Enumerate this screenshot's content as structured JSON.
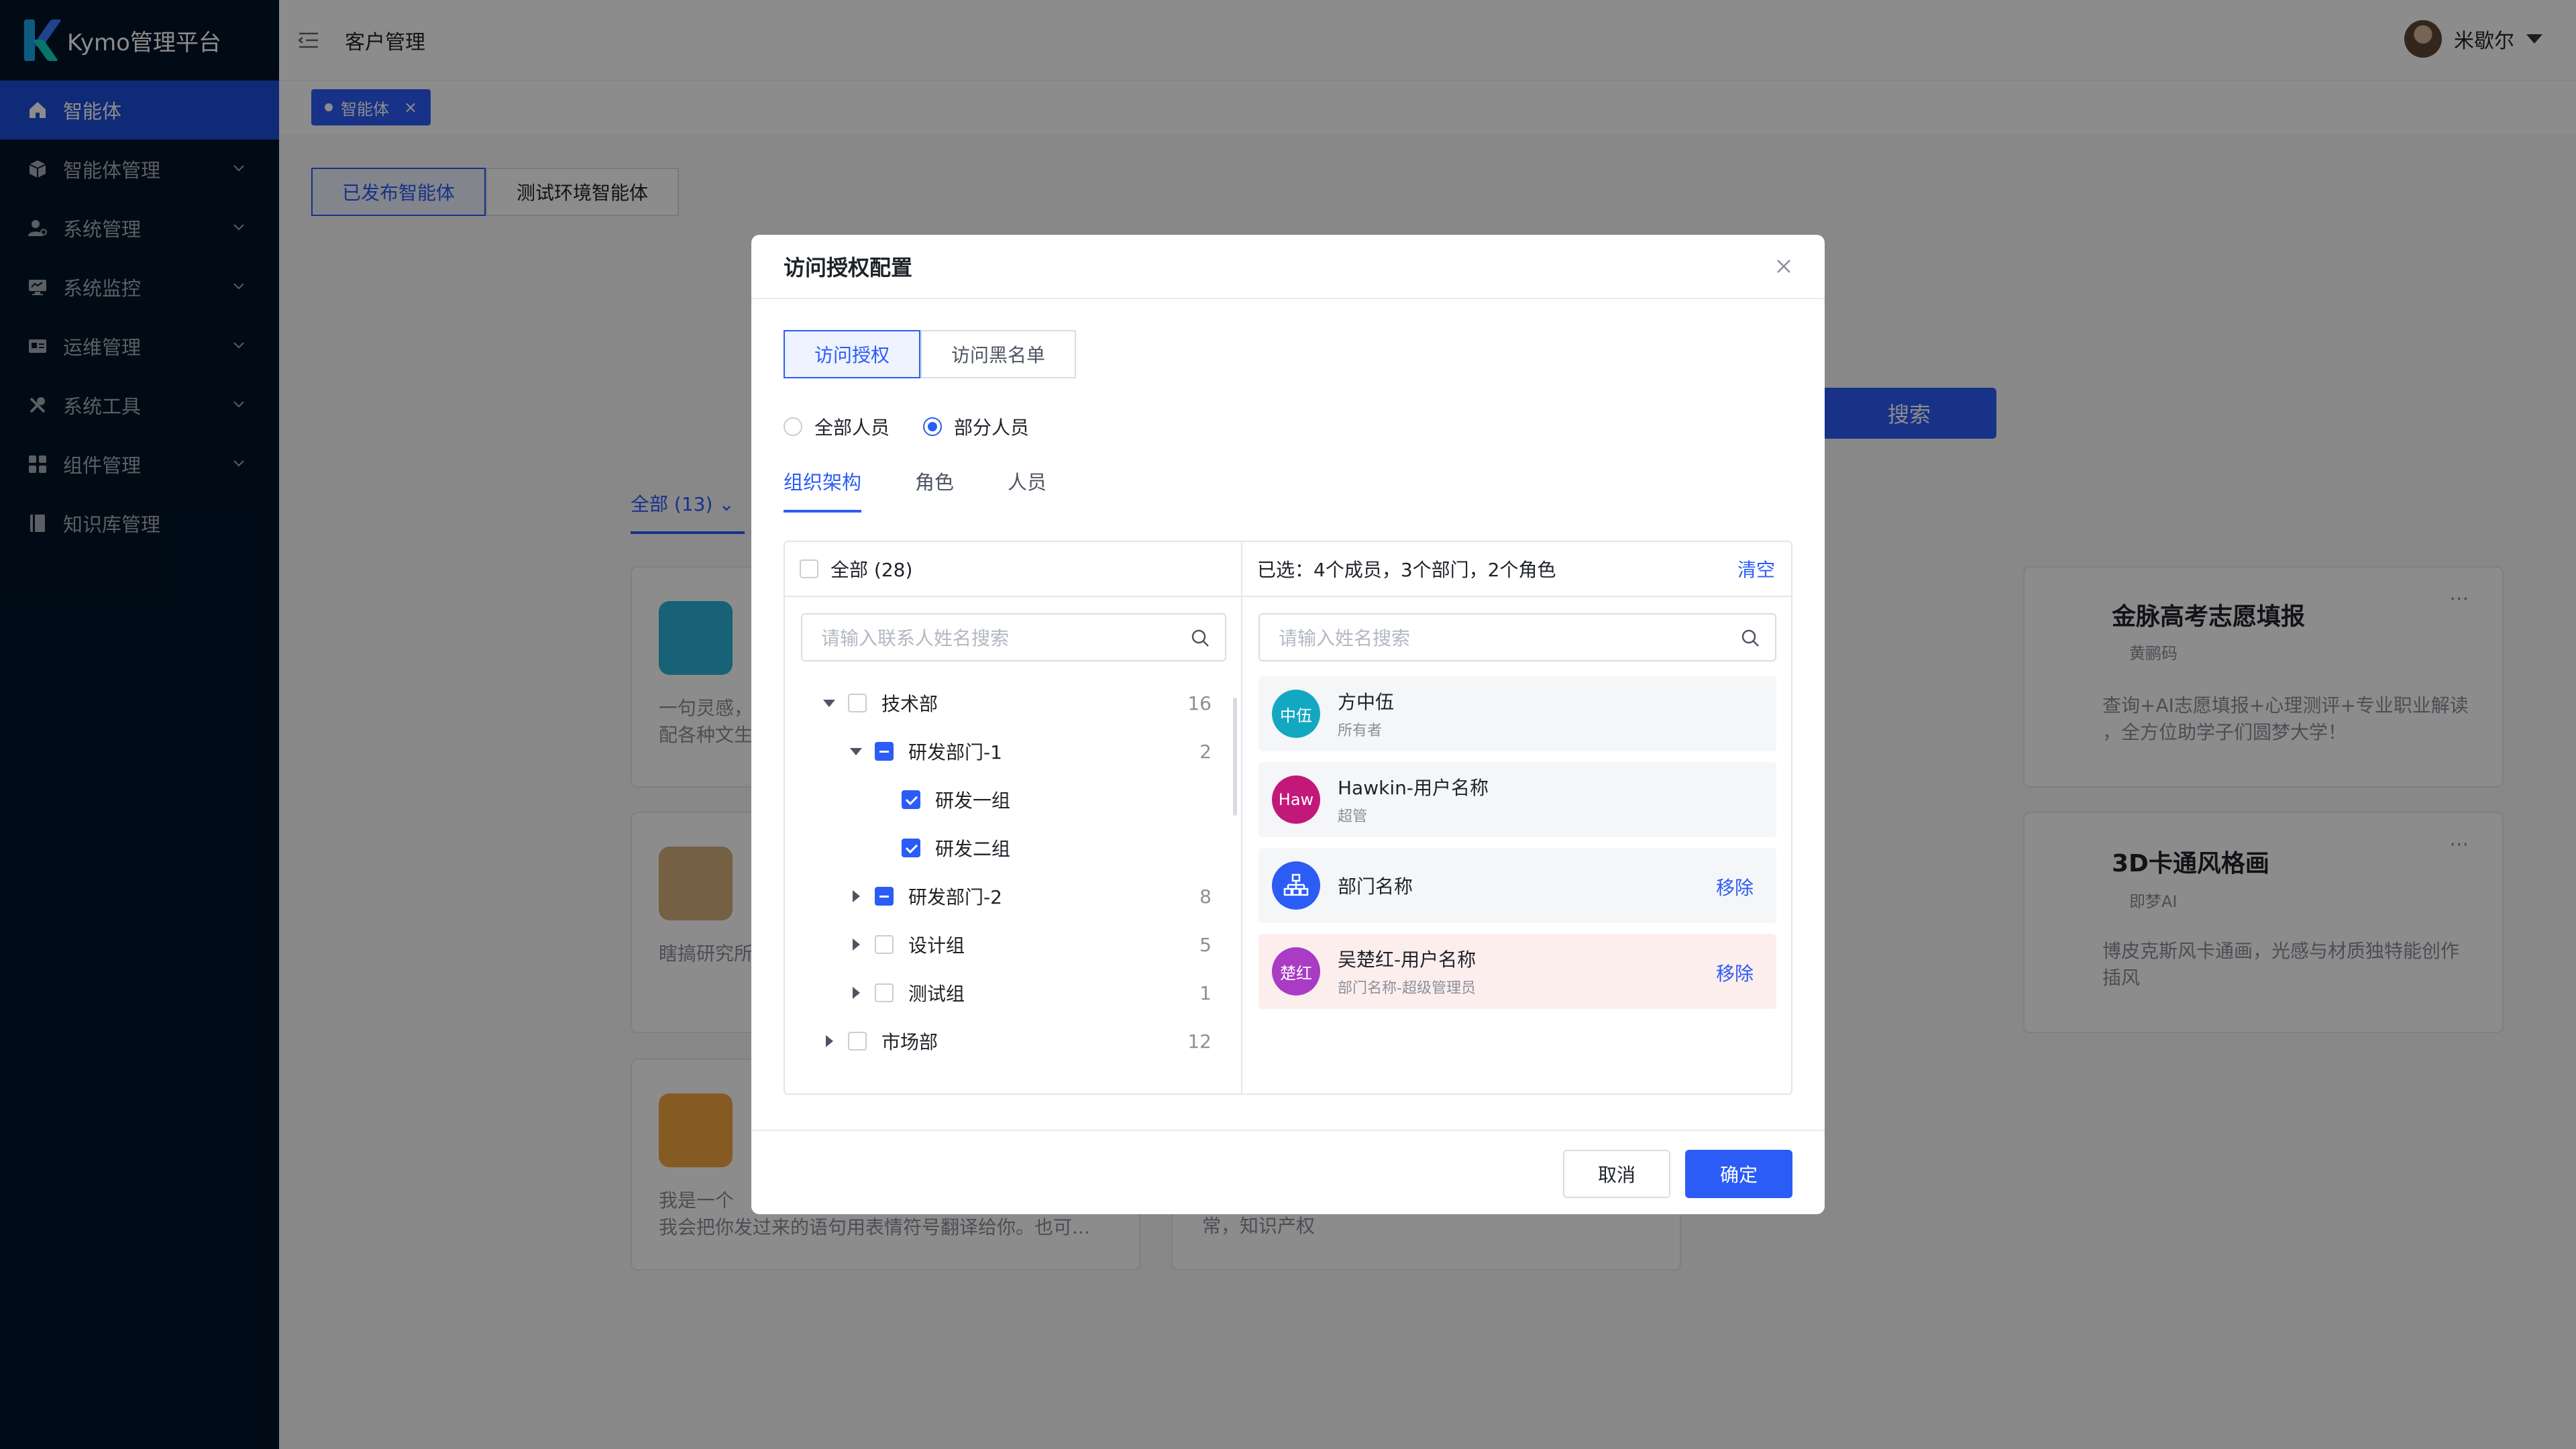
{
  "app": {
    "title": "Kymo管理平台"
  },
  "sidebar": {
    "items": [
      {
        "label": "智能体",
        "icon": "home-icon",
        "active": true
      },
      {
        "label": "智能体管理",
        "icon": "cube-icon"
      },
      {
        "label": "系统管理",
        "icon": "user-settings-icon"
      },
      {
        "label": "系统监控",
        "icon": "monitor-icon"
      },
      {
        "label": "运维管理",
        "icon": "id-card-icon"
      },
      {
        "label": "系统工具",
        "icon": "tools-icon"
      },
      {
        "label": "组件管理",
        "icon": "grid-icon"
      },
      {
        "label": "知识库管理",
        "icon": "book-icon"
      }
    ]
  },
  "header": {
    "title": "客户管理",
    "username": "米歇尔"
  },
  "tagbar": {
    "tag_label": "智能体"
  },
  "main": {
    "seg": [
      "已发布智能体",
      "测试环境智能体"
    ],
    "search_button": "搜索",
    "all_tab": "全部 (13)",
    "cards": [
      {
        "title": "",
        "sub": "",
        "desc1": "一句灵感，",
        "desc2": "配各种文生"
      },
      {
        "title": "金脉高考志愿填报",
        "sub": "黄鹂码",
        "desc1": "查询+AI志愿填报+心理测评+专业职业解读",
        "desc2": "，全方位助学子们圆梦大学！"
      },
      {
        "title": "",
        "sub": "",
        "desc1": "瞎搞研究所",
        "desc2": ""
      },
      {
        "title": "3D卡通风格画",
        "sub": "即梦AI",
        "desc1": "博皮克斯风卡通画，光感与材质独特能创作",
        "desc2": "插风"
      },
      {
        "title": "",
        "sub": "",
        "desc1": "我是一个",
        "desc2": "我会把你发过来的语句用表情符号翻译给你。也可..."
      },
      {
        "title": "",
        "sub": "",
        "desc1": "常，知识产权",
        "desc2": ""
      }
    ]
  },
  "modal": {
    "title": "访问授权配置",
    "tabs": [
      "访问授权",
      "访问黑名单"
    ],
    "radios": [
      "全部人员",
      "部分人员"
    ],
    "subtabs": [
      "组织架构",
      "角色",
      "人员"
    ],
    "left": {
      "header": "全部 (28)",
      "search_placeholder": "请输入联系人姓名搜索",
      "tree": [
        {
          "label": "技术部",
          "count": "16"
        },
        {
          "label": "研发部门-1",
          "count": "2"
        },
        {
          "label": "研发一组",
          "count": ""
        },
        {
          "label": "研发二组",
          "count": ""
        },
        {
          "label": "研发部门-2",
          "count": "8"
        },
        {
          "label": "设计组",
          "count": "5"
        },
        {
          "label": "测试组",
          "count": "1"
        },
        {
          "label": "市场部",
          "count": "12"
        }
      ]
    },
    "right": {
      "header": "已选：4个成员，3个部门，2个角色",
      "clear": "清空",
      "search_placeholder": "请输入姓名搜索",
      "items": [
        {
          "avatar": "中伍",
          "name": "方中伍",
          "sub": "所有者",
          "color": "#13a8c2",
          "remove": ""
        },
        {
          "avatar": "Haw",
          "name": "Hawkin-用户名称",
          "sub": "超管",
          "color": "#c2187a",
          "remove": ""
        },
        {
          "avatar": "",
          "name": "部门名称",
          "sub": "",
          "color": "#2b5cf6",
          "remove": "移除"
        },
        {
          "avatar": "楚红",
          "name": "吴楚红-用户名称",
          "sub": "部门名称-超级管理员",
          "color": "#a93bc4",
          "remove": "移除"
        }
      ]
    },
    "cancel": "取消",
    "ok": "确定"
  },
  "colors": {
    "primary": "#2b5cf6",
    "sidebar": "#001529",
    "danger_bg": "#fdeeee"
  }
}
